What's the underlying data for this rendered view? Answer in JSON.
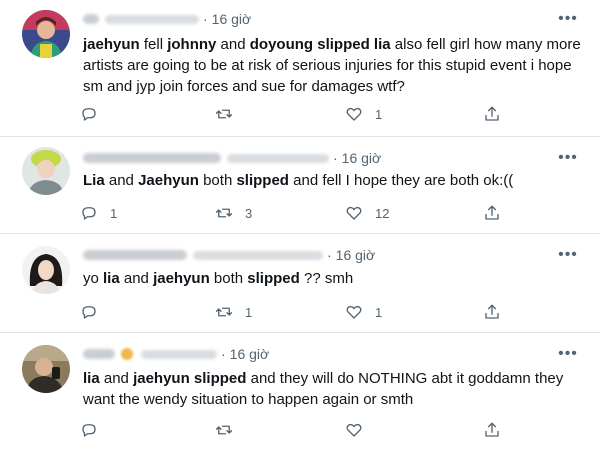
{
  "tweets": [
    {
      "time": "16 giờ",
      "dot": "·",
      "segments": [
        {
          "t": "jaehyun",
          "b": true
        },
        {
          "t": " fell ",
          "b": false
        },
        {
          "t": "johnny",
          "b": true
        },
        {
          "t": " and ",
          "b": false
        },
        {
          "t": "doyoung",
          "b": true
        },
        {
          "t": " ",
          "b": false
        },
        {
          "t": "slipped lia",
          "b": true
        },
        {
          "t": " also fell girl how many more artists are going to be at risk of serious injuries for this stupid event i hope sm and jyp join forces and sue for damages wtf?",
          "b": false
        }
      ],
      "reply_count": "",
      "retweet_count": "",
      "like_count": "1"
    },
    {
      "time": "16 giờ",
      "dot": "·",
      "segments": [
        {
          "t": "Lia",
          "b": true
        },
        {
          "t": " and ",
          "b": false
        },
        {
          "t": "Jaehyun",
          "b": true
        },
        {
          "t": " both ",
          "b": false
        },
        {
          "t": "slipped",
          "b": true
        },
        {
          "t": " and fell I hope they are both ok:((",
          "b": false
        }
      ],
      "reply_count": "1",
      "retweet_count": "3",
      "like_count": "12"
    },
    {
      "time": "16 giờ",
      "dot": "·",
      "segments": [
        {
          "t": "yo ",
          "b": false
        },
        {
          "t": "lia",
          "b": true
        },
        {
          "t": " and ",
          "b": false
        },
        {
          "t": "jaehyun",
          "b": true
        },
        {
          "t": " both ",
          "b": false
        },
        {
          "t": "slipped",
          "b": true
        },
        {
          "t": " ?? smh",
          "b": false
        }
      ],
      "reply_count": "",
      "retweet_count": "1",
      "like_count": "1"
    },
    {
      "time": "16 giờ",
      "dot": "·",
      "segments": [
        {
          "t": "lia",
          "b": true
        },
        {
          "t": " and ",
          "b": false
        },
        {
          "t": "jaehyun",
          "b": true
        },
        {
          "t": " ",
          "b": false
        },
        {
          "t": "slipped",
          "b": true
        },
        {
          "t": " and they will do NOTHING abt it goddamn  they want the wendy situation to happen again or smth",
          "b": false
        }
      ],
      "reply_count": "",
      "retweet_count": "",
      "like_count": ""
    }
  ],
  "icons": {
    "reply": "reply-icon",
    "retweet": "retweet-icon",
    "like": "heart-icon",
    "share": "share-icon",
    "more": "more-icon"
  },
  "colors": {
    "text": "#0f1419",
    "secondary": "#536471",
    "divider": "#dfe4e8"
  }
}
